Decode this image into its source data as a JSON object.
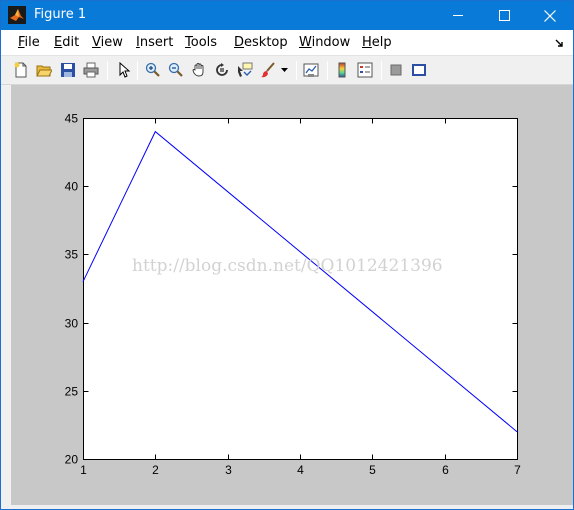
{
  "window": {
    "title": "Figure 1",
    "minimize_icon": "minimize-icon",
    "maximize_icon": "maximize-icon",
    "close_icon": "close-icon"
  },
  "menu": {
    "items": [
      {
        "label": "File",
        "accel": "F",
        "rest": "ile"
      },
      {
        "label": "Edit",
        "accel": "E",
        "rest": "dit"
      },
      {
        "label": "View",
        "accel": "V",
        "rest": "iew"
      },
      {
        "label": "Insert",
        "accel": "I",
        "rest": "nsert"
      },
      {
        "label": "Tools",
        "accel": "T",
        "rest": "ools"
      },
      {
        "label": "Desktop",
        "accel": "D",
        "rest": "esktop"
      },
      {
        "label": "Window",
        "accel": "W",
        "rest": "indow"
      },
      {
        "label": "Help",
        "accel": "H",
        "rest": "elp"
      }
    ]
  },
  "toolbar": {
    "buttons": [
      "new-figure-icon",
      "open-file-icon",
      "save-icon",
      "print-icon",
      "edit-plot-icon",
      "zoom-in-icon",
      "zoom-out-icon",
      "pan-icon",
      "rotate-3d-icon",
      "data-cursor-icon",
      "brush-icon",
      "link-plot-icon",
      "colorbar-icon",
      "legend-icon",
      "hide-plot-tools-icon",
      "show-plot-tools-icon"
    ]
  },
  "watermark": "http://blog.csdn.net/QQ1012421396",
  "colors": {
    "titlebar": "#0a7ad8",
    "figure_bg": "#c8c8c8",
    "axes_bg": "#ffffff",
    "line": "#0000ff"
  },
  "chart_data": {
    "type": "line",
    "title": "",
    "xlabel": "",
    "ylabel": "",
    "x": [
      1,
      2,
      7
    ],
    "series": [
      {
        "values": [
          33,
          44,
          22
        ]
      }
    ],
    "xlim": [
      1,
      7
    ],
    "ylim": [
      20,
      45
    ],
    "xticks": [
      1,
      2,
      3,
      4,
      5,
      6,
      7
    ],
    "yticks": [
      20,
      25,
      30,
      35,
      40,
      45
    ],
    "grid": false,
    "legend": false
  }
}
